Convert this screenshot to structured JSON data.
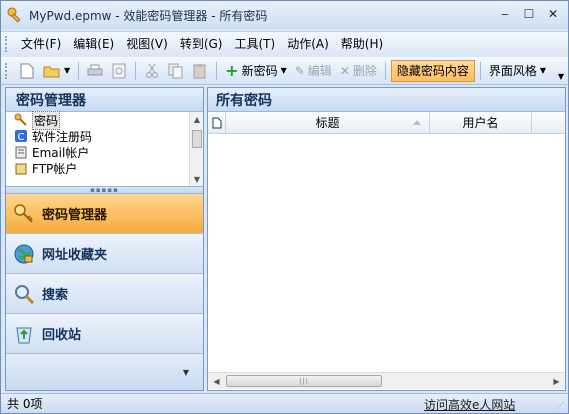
{
  "window": {
    "title": "MyPwd.epmw - 效能密码管理器 - 所有密码",
    "controls": [
      "minimize",
      "maximize",
      "close"
    ]
  },
  "menu": [
    "文件(F)",
    "编辑(E)",
    "视图(V)",
    "转到(G)",
    "工具(T)",
    "动作(A)",
    "帮助(H)"
  ],
  "toolbar": {
    "new_label": "新密码",
    "edit_label": "编辑",
    "delete_label": "删除",
    "hide_label": "隐藏密码内容",
    "skin_label": "界面风格"
  },
  "left": {
    "header": "密码管理器",
    "tree": [
      "密码",
      "软件注册码",
      "Email帐户",
      "FTP帐户"
    ],
    "nav": [
      "密码管理器",
      "网址收藏夹",
      "搜索",
      "回收站"
    ]
  },
  "right": {
    "header": "所有密码",
    "columns": [
      "标题",
      "用户名"
    ]
  },
  "status": {
    "count": "共 0项",
    "link": "访问高效e人网站"
  },
  "colors": {
    "accent": "#f6ac3d",
    "frame": "#d9e7f7",
    "header_text": "#15335c"
  }
}
